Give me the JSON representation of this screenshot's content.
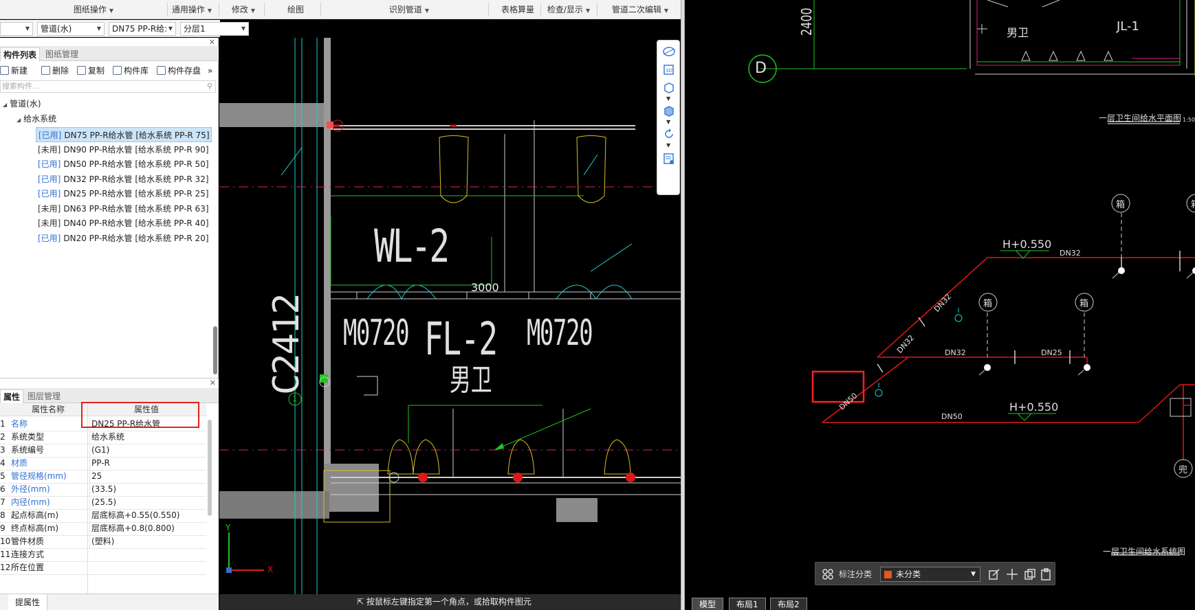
{
  "toolbar": {
    "menus": [
      {
        "label": "图纸操作",
        "dropdown": true
      },
      {
        "label": "通用操作",
        "dropdown": true
      },
      {
        "label": "修改",
        "dropdown": true
      },
      {
        "label": "绘图",
        "dropdown": false
      },
      {
        "label": "识别管道",
        "dropdown": true
      },
      {
        "label": "表格算量",
        "dropdown": false
      },
      {
        "label": "检查/显示",
        "dropdown": true
      },
      {
        "label": "管道二次编辑",
        "dropdown": true
      }
    ]
  },
  "filters": {
    "combo1": "",
    "combo2": "管道(水)",
    "combo3": "DN75  PP-R给:",
    "combo4": "分层1"
  },
  "component_panel": {
    "tabs": [
      "构件列表",
      "图纸管理"
    ],
    "actions": [
      "新建",
      "删除",
      "复制",
      "构件库",
      "构件存盘"
    ],
    "search_placeholder": "搜索构件...",
    "tree": {
      "root": "管道(水)",
      "child": "给水系统",
      "items": [
        {
          "status": "[已用]",
          "used": true,
          "text": "DN75  PP-R给水管 [给水系统 PP-R 75]",
          "selected": true
        },
        {
          "status": "[未用]",
          "used": false,
          "text": "DN90 PP-R给水管 [给水系统 PP-R 90]",
          "selected": false
        },
        {
          "status": "[已用]",
          "used": true,
          "text": "DN50  PP-R给水管 [给水系统 PP-R 50]",
          "selected": false
        },
        {
          "status": "[已用]",
          "used": true,
          "text": "DN32  PP-R给水管 [给水系统 PP-R 32]",
          "selected": false
        },
        {
          "status": "[已用]",
          "used": true,
          "text": "DN25  PP-R给水管 [给水系统 PP-R 25]",
          "selected": false
        },
        {
          "status": "[未用]",
          "used": false,
          "text": "DN63  PP-R给水管 [给水系统 PP-R 63]",
          "selected": false
        },
        {
          "status": "[未用]",
          "used": false,
          "text": "DN40  PP-R给水管 [给水系统 PP-R 40]",
          "selected": false
        },
        {
          "status": "[已用]",
          "used": true,
          "text": "DN20  PP-R给水管 [给水系统 PP-R 20]",
          "selected": false
        }
      ]
    }
  },
  "property_panel": {
    "tabs": [
      "属性",
      "图层管理"
    ],
    "header_name": "属性名称",
    "header_value": "属性值",
    "rows": [
      {
        "num": "1",
        "name": "名称",
        "value": "DN25  PP-R给水管",
        "blue": true
      },
      {
        "num": "2",
        "name": "系统类型",
        "value": "给水系统",
        "blue": false
      },
      {
        "num": "3",
        "name": "系统编号",
        "value": "(G1)",
        "blue": false
      },
      {
        "num": "4",
        "name": "材质",
        "value": "PP-R",
        "blue": true
      },
      {
        "num": "5",
        "name": "管径规格(mm)",
        "value": "25",
        "blue": true
      },
      {
        "num": "6",
        "name": "外径(mm)",
        "value": "(33.5)",
        "blue": true
      },
      {
        "num": "7",
        "name": "内径(mm)",
        "value": "(25.5)",
        "blue": true
      },
      {
        "num": "8",
        "name": "起点标高(m)",
        "value": "层底标高+0.55(0.550)",
        "blue": false
      },
      {
        "num": "9",
        "name": "终点标高(m)",
        "value": "层底标高+0.8(0.800)",
        "blue": false
      },
      {
        "num": "10",
        "name": "管件材质",
        "value": "(塑料)",
        "blue": false
      },
      {
        "num": "11",
        "name": "连接方式",
        "value": "",
        "blue": false
      },
      {
        "num": "12",
        "name": "所在位置",
        "value": "",
        "blue": false
      }
    ],
    "footer_button": "提属性"
  },
  "cad_left": {
    "labels": {
      "wl": "WL-2",
      "dim": "3000",
      "c2412": "C2412",
      "m0720a": "M0720",
      "fl": "FL-2",
      "m0720b": "M0720",
      "room": "男卫",
      "axis": "1",
      "axis_y": "Y",
      "axis_x": "X"
    },
    "status_text": "按鼠标左键指定第一个角点，或拾取构件图元"
  },
  "cad_right": {
    "labels": {
      "dim": "2400",
      "axis_d": "D",
      "room": "男卫",
      "jl": "JL-1",
      "title1": "一层卫生间给水平面图",
      "scale": "1:50",
      "h1": "H+0.550",
      "h2": "H+0.550",
      "dn32a": "DN32",
      "dn32b": "DN32",
      "dn32c": "DN32",
      "dn32d": "DN32",
      "dn25": "DN25",
      "dn50a": "DN50",
      "dn50b": "DN50",
      "xiang1": "箱",
      "xiang2": "箱",
      "xiang3": "箱",
      "xiang4": "箱",
      "dou": "兜",
      "title2": "一层卫生间给水系统图"
    },
    "annotation_toolbar": {
      "label": "标注分类",
      "selected": "未分类",
      "swatch_color": "#e8561b"
    },
    "layout_tabs": [
      "模型",
      "布局1",
      "布局2"
    ]
  },
  "colors": {
    "pipe_red": "#e01818",
    "wall_gray": "#8a8a8a",
    "cad_green": "#22c322",
    "cad_cyan": "#20d0d0",
    "cad_yellow": "#d8c020",
    "cad_magenta": "#d0207a",
    "highlight_red": "#ff2020"
  }
}
